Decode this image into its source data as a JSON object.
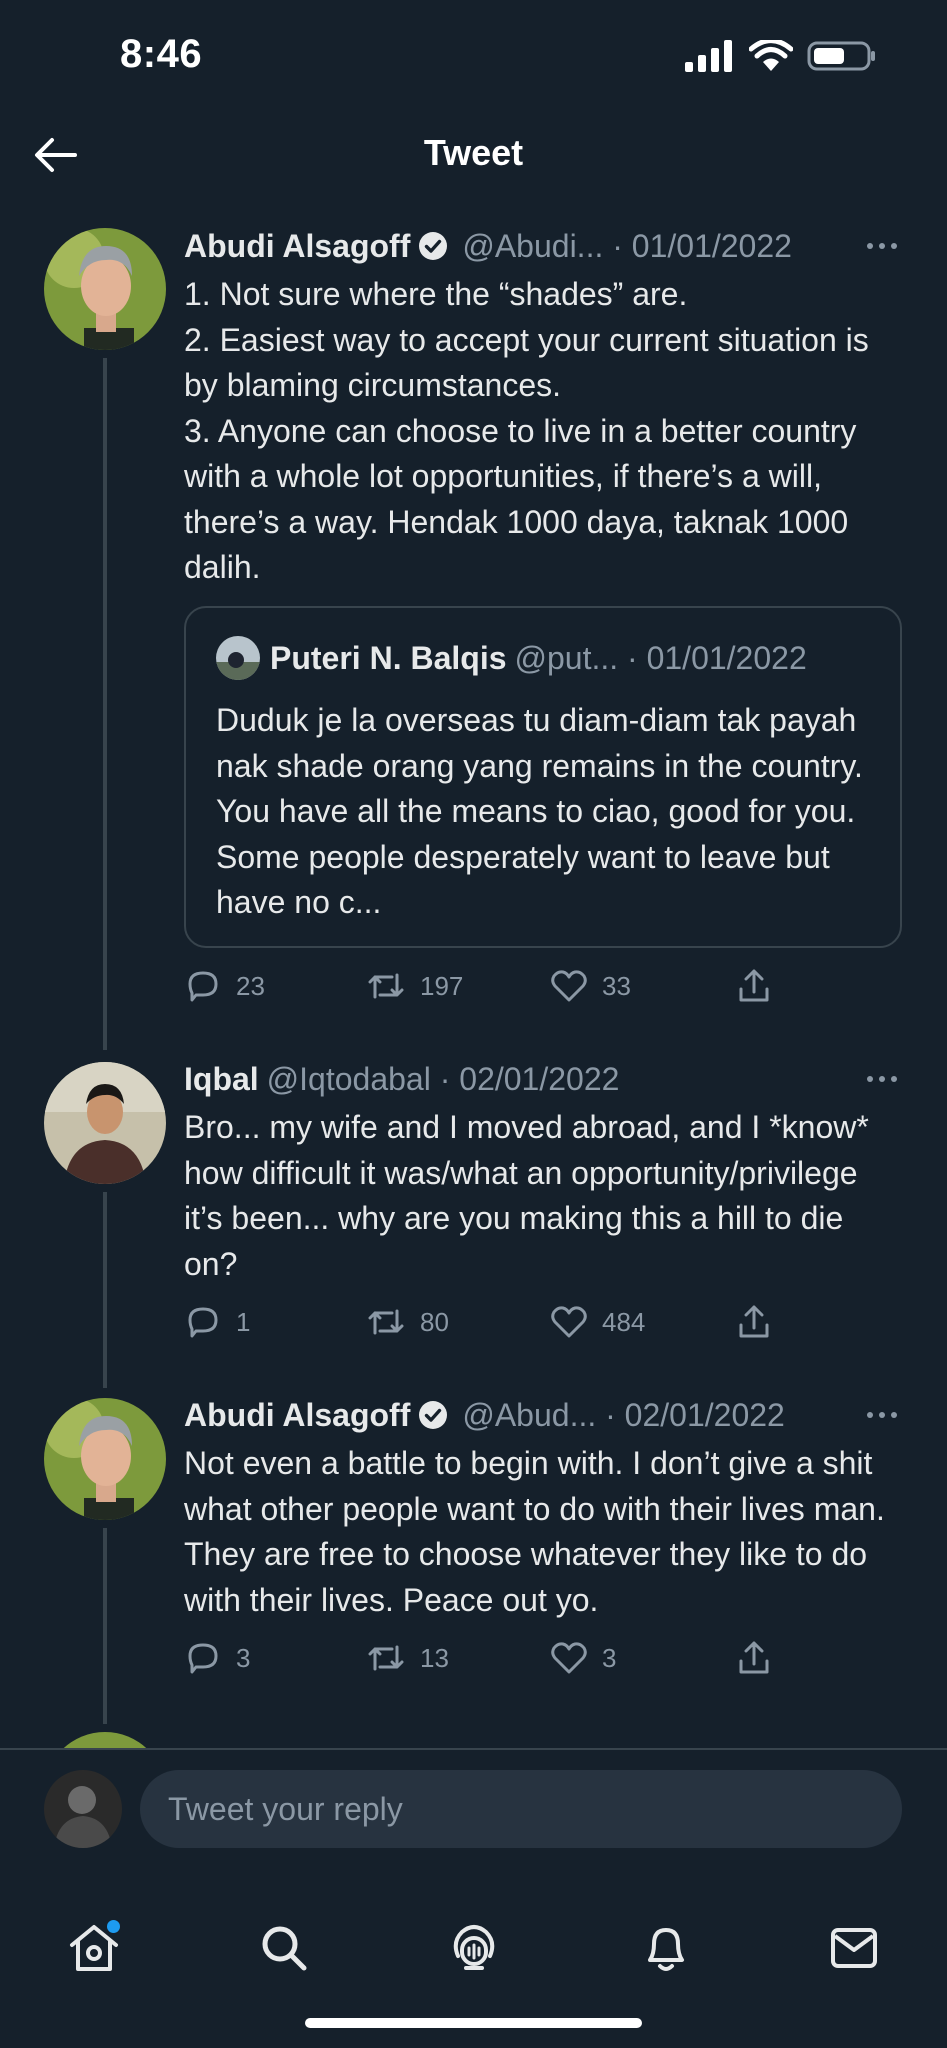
{
  "status_bar": {
    "time": "8:46"
  },
  "header": {
    "title": "Tweet"
  },
  "tweets": [
    {
      "author": "Abudi Alsagoff",
      "verified": true,
      "handle_date": "@Abudi... · 01/01/2022",
      "text": "1. Not sure where the “shades” are.\n2. Easiest way to accept your current situation is by blaming circumstances.\n3. Anyone can choose to live in a better country with a whole lot opportunities, if there’s a will, there’s a way. Hendak 1000 daya, taknak 1000 dalih.",
      "quote": {
        "author": "Puteri N. Balqis",
        "handle_date": "@put... · 01/01/2022",
        "text": "Duduk je la overseas tu diam-diam tak payah nak shade orang yang remains in the country. You have all the means to ciao, good for you. Some people desperately want to leave but have no c..."
      },
      "replies": "23",
      "retweets": "197",
      "likes": "33"
    },
    {
      "author": "Iqbal",
      "verified": false,
      "handle_date": "@Iqtodabal · 02/01/2022",
      "text": "Bro... my wife and I moved abroad, and I *know* how difficult it was/what an opportunity/privilege it’s been... why are you making this a hill to die on?",
      "replies": "1",
      "retweets": "80",
      "likes": "484"
    },
    {
      "author": "Abudi Alsagoff",
      "verified": true,
      "handle_date": "@Abud... · 02/01/2022",
      "text": "Not even a battle to begin with. I don’t give a shit what other people want to do with their lives man. They are free to choose whatever they like to do with their lives. Peace out yo.",
      "replies": "3",
      "retweets": "13",
      "likes": "3"
    }
  ],
  "reply_bar": {
    "placeholder": "Tweet your reply"
  },
  "bottom_nav": {
    "items": [
      "home-icon",
      "search-icon",
      "spaces-icon",
      "notifications-icon",
      "messages-icon"
    ],
    "home_has_notification": true
  },
  "colors": {
    "background": "#15202b",
    "text": "#e7e9ea",
    "secondary_text": "#8b98a5",
    "border": "#38444d",
    "accent": "#1d9bf0",
    "input_bg": "#273340"
  }
}
